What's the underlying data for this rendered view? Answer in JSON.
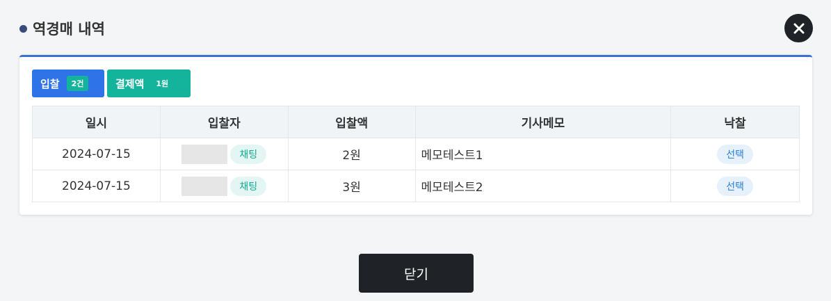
{
  "header": {
    "title": "역경매 내역"
  },
  "summary": {
    "bid_label": "입찰",
    "bid_count": "2건",
    "pay_label": "결제액",
    "pay_amount": "1원"
  },
  "table": {
    "headers": [
      "일시",
      "입찰자",
      "입찰액",
      "기사메모",
      "낙찰"
    ],
    "rows": [
      {
        "date": "2024-07-15",
        "chat": "채팅",
        "amount": "2원",
        "memo": "메모테스트1",
        "select": "선택"
      },
      {
        "date": "2024-07-15",
        "chat": "채팅",
        "amount": "3원",
        "memo": "메모테스트2",
        "select": "선택"
      }
    ]
  },
  "footer": {
    "close_label": "닫기"
  },
  "colors": {
    "accent": "#2f73e8",
    "teal": "#14b49c",
    "dark": "#1f2226"
  },
  "icons": {
    "close": "close-icon",
    "title_marker": "dot-icon"
  }
}
